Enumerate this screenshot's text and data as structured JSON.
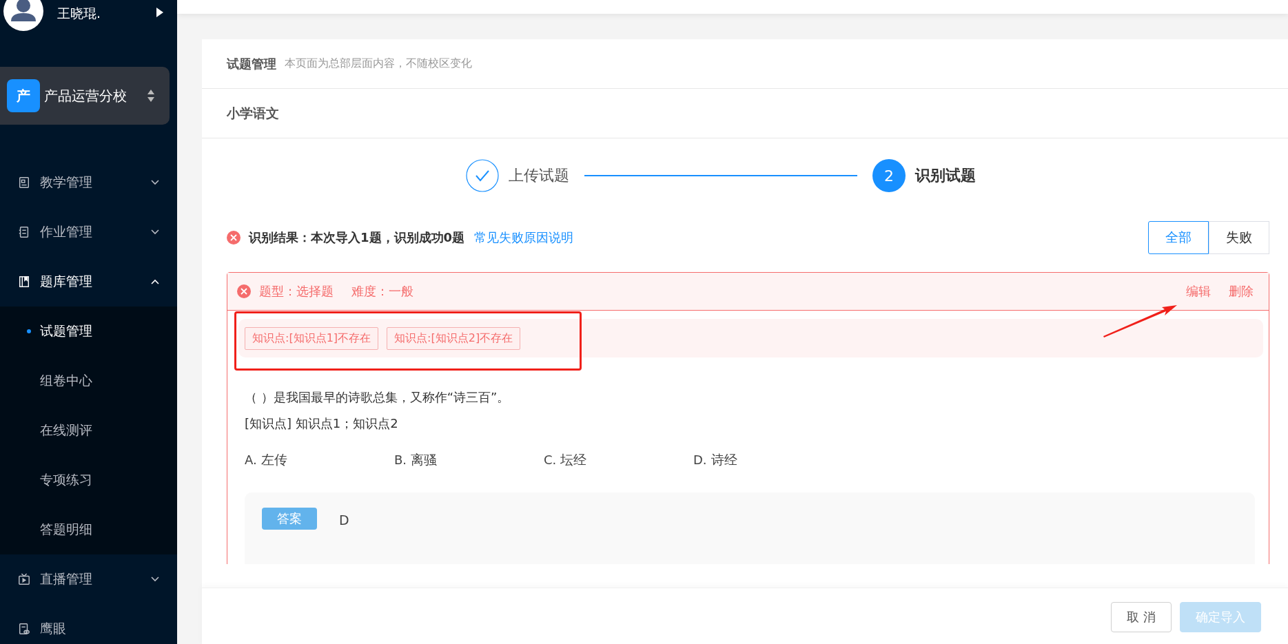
{
  "user": {
    "name": "王晓琨."
  },
  "school": {
    "badge": "产",
    "name": "产品运营分校"
  },
  "nav": [
    {
      "label": "教学管理",
      "kind": "group",
      "expanded": false
    },
    {
      "label": "作业管理",
      "kind": "group",
      "expanded": false
    },
    {
      "label": "题库管理",
      "kind": "group",
      "expanded": true,
      "children": [
        {
          "label": "试题管理",
          "selected": true
        },
        {
          "label": "组卷中心",
          "selected": false
        },
        {
          "label": "在线测评",
          "selected": false
        },
        {
          "label": "专项练习",
          "selected": false
        },
        {
          "label": "答题明细",
          "selected": false
        }
      ]
    },
    {
      "label": "直播管理",
      "kind": "group",
      "expanded": false
    },
    {
      "label": "鹰眼",
      "kind": "link"
    }
  ],
  "page_header": {
    "title": "试题管理",
    "note": "本页面为总部层面内容，不随校区变化"
  },
  "subject": "小学语文",
  "steps": [
    {
      "label": "上传试题",
      "done": true
    },
    {
      "number": "2",
      "label": "识别试题",
      "done": false
    }
  ],
  "result": {
    "text": "识别结果：本次导入1题，识别成功0题",
    "link": "常见失败原因说明"
  },
  "filters": [
    {
      "label": "全部",
      "selected": true
    },
    {
      "label": "失败",
      "selected": false
    }
  ],
  "question": {
    "type_label": "题型：选择题",
    "difficulty_label": "难度：一般",
    "actions": [
      "编辑",
      "删除"
    ],
    "errors": [
      "知识点:[知识点1]不存在",
      "知识点:[知识点2]不存在"
    ],
    "stem": "（ ）是我国最早的诗歌总集，又称作“诗三百”。",
    "knowledge": "[知识点] 知识点1；知识点2",
    "options": [
      {
        "letter": "A.",
        "text": "左传"
      },
      {
        "letter": "B.",
        "text": "离骚"
      },
      {
        "letter": "C.",
        "text": "坛经"
      },
      {
        "letter": "D.",
        "text": "诗经"
      }
    ],
    "answer": {
      "label": "答案",
      "value": "D"
    }
  },
  "footer_buttons": [
    {
      "label": "取 消",
      "kind": "secondary",
      "disabled": false
    },
    {
      "label": "确定导入",
      "kind": "primary",
      "disabled": true
    }
  ]
}
